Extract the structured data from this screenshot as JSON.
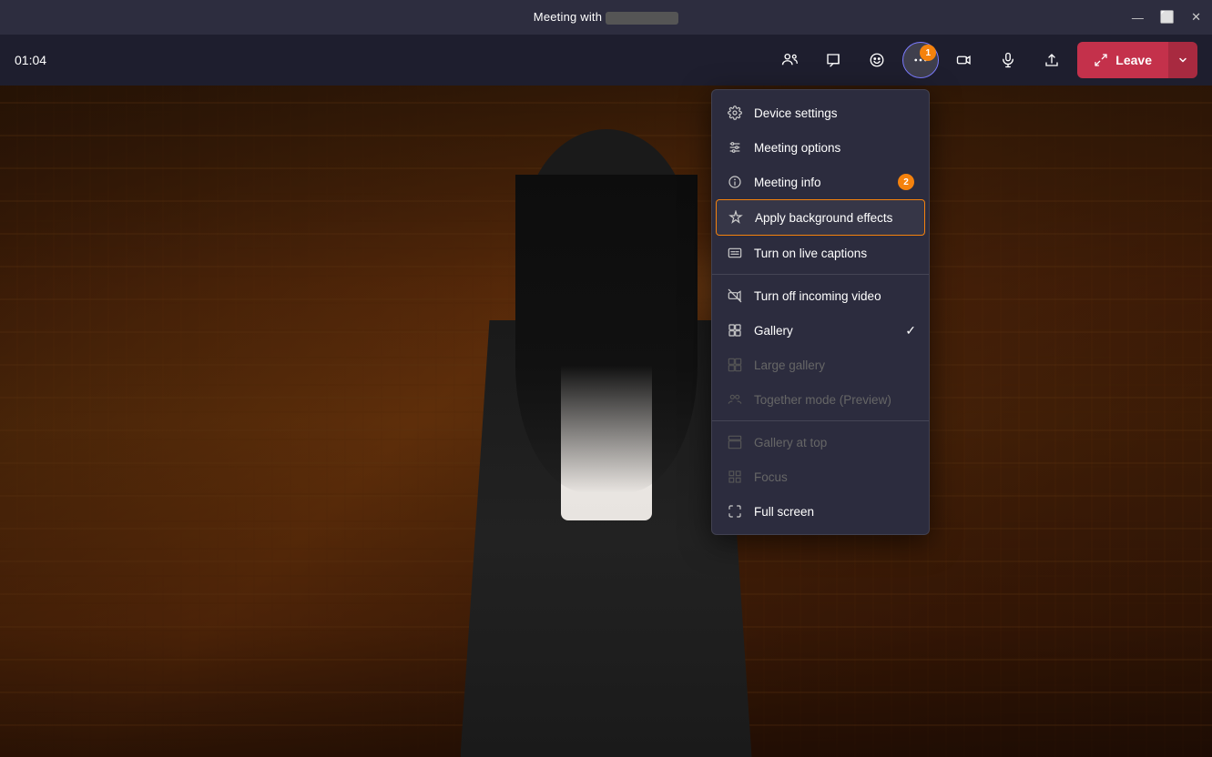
{
  "titleBar": {
    "title": "Meeting with",
    "windowControls": {
      "minimize": "—",
      "maximize": "⬜",
      "close": "✕"
    }
  },
  "toolbar": {
    "timer": "01:04",
    "buttons": [
      {
        "name": "people",
        "label": "People"
      },
      {
        "name": "chat",
        "label": "Chat"
      },
      {
        "name": "reactions",
        "label": "Reactions"
      },
      {
        "name": "more",
        "label": "More",
        "badge": "1"
      },
      {
        "name": "camera",
        "label": "Camera"
      },
      {
        "name": "mic",
        "label": "Microphone"
      },
      {
        "name": "share",
        "label": "Share"
      }
    ],
    "leave": "Leave"
  },
  "menu": {
    "items": [
      {
        "id": "device-settings",
        "label": "Device settings",
        "icon": "gear",
        "disabled": false,
        "highlighted": false
      },
      {
        "id": "meeting-options",
        "label": "Meeting options",
        "icon": "sliders",
        "disabled": false,
        "highlighted": false
      },
      {
        "id": "meeting-info",
        "label": "Meeting info",
        "icon": "info",
        "disabled": false,
        "highlighted": false,
        "badge": "2"
      },
      {
        "id": "apply-background",
        "label": "Apply background effects",
        "icon": "sparkle",
        "disabled": false,
        "highlighted": true
      },
      {
        "id": "live-captions",
        "label": "Turn on live captions",
        "icon": "captions",
        "disabled": false,
        "highlighted": false
      },
      {
        "id": "divider1",
        "type": "divider"
      },
      {
        "id": "turn-off-video",
        "label": "Turn off incoming video",
        "icon": "video-off",
        "disabled": false,
        "highlighted": false
      },
      {
        "id": "gallery",
        "label": "Gallery",
        "icon": "grid",
        "disabled": false,
        "highlighted": false,
        "checked": true
      },
      {
        "id": "large-gallery",
        "label": "Large gallery",
        "icon": "grid-large",
        "disabled": true,
        "highlighted": false
      },
      {
        "id": "together-mode",
        "label": "Together mode (Preview)",
        "icon": "together",
        "disabled": true,
        "highlighted": false
      },
      {
        "id": "divider2",
        "type": "divider"
      },
      {
        "id": "gallery-top",
        "label": "Gallery at top",
        "icon": "gallery-top",
        "disabled": true,
        "highlighted": false
      },
      {
        "id": "focus",
        "label": "Focus",
        "icon": "focus",
        "disabled": true,
        "highlighted": false
      },
      {
        "id": "full-screen",
        "label": "Full screen",
        "icon": "fullscreen",
        "disabled": false,
        "highlighted": false
      }
    ]
  }
}
